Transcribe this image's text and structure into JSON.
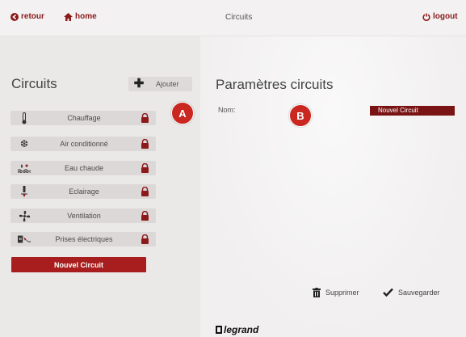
{
  "topbar": {
    "back_label": "retour",
    "home_label": "home",
    "title": "Circuits",
    "logout_label": "logout"
  },
  "left": {
    "title": "Circuits",
    "add_label": "Ajouter",
    "items": [
      {
        "label": "Chauffage",
        "icon": "thermometer-icon"
      },
      {
        "label": "Air conditionné",
        "icon": "snowflake-icon"
      },
      {
        "label": "Eau chaude",
        "icon": "water-heater-icon"
      },
      {
        "label": "Eclairage",
        "icon": "light-bulb-icon"
      },
      {
        "label": "Ventilation",
        "icon": "fan-icon"
      },
      {
        "label": "Prises électriques",
        "icon": "plug-icon"
      }
    ],
    "new_button": "Nouvel Circuit"
  },
  "right": {
    "title": "Paramètres circuits",
    "name_label": "Nom:",
    "name_value": "Nouvel Circuit",
    "delete_label": "Supprimer",
    "save_label": "Sauvegarder"
  },
  "badges": {
    "a": "A",
    "b": "B"
  },
  "footer": {
    "logo": "legrand"
  },
  "colors": {
    "accent": "#a81e1e",
    "dark_accent": "#7a1414",
    "badge": "#c9271f"
  }
}
